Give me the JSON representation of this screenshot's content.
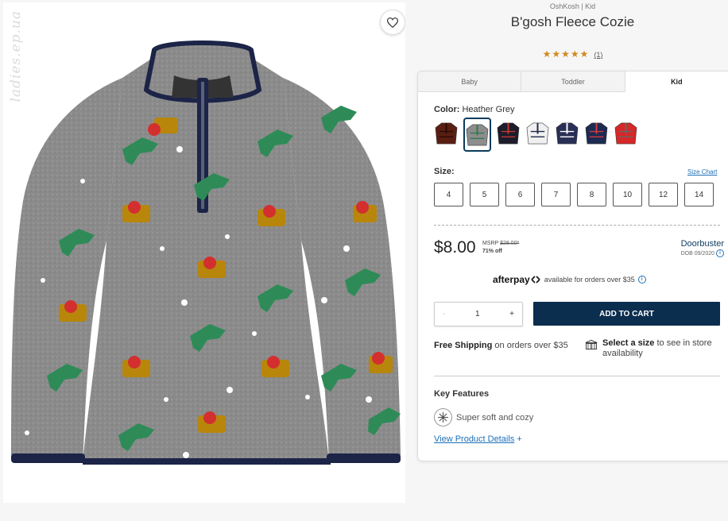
{
  "watermark": "ladies.ep.ua",
  "product": {
    "brand_line": "OshKosh | Kid",
    "title": "B'gosh Fleece Cozie",
    "stars": "★★★★★",
    "review_count": "(1)"
  },
  "tabs": [
    {
      "label": "Baby",
      "active": false
    },
    {
      "label": "Toddler",
      "active": false
    },
    {
      "label": "Kid",
      "active": true
    }
  ],
  "color": {
    "label": "Color:",
    "selected": "Heather Grey",
    "swatches": [
      {
        "name": "brown-plaid",
        "main": "#5a1e12",
        "accent": "#2a0c06"
      },
      {
        "name": "heather-grey",
        "main": "#8d8d8d",
        "accent": "#2f7a4d"
      },
      {
        "name": "black-stripe",
        "main": "#1c1c2c",
        "accent": "#c0392b"
      },
      {
        "name": "white-navy",
        "main": "#f0f0f0",
        "accent": "#1f2a4a"
      },
      {
        "name": "navy-plaid",
        "main": "#2a2f55",
        "accent": "#ffffff"
      },
      {
        "name": "navy-fairisle",
        "main": "#1d2a52",
        "accent": "#d23b3b"
      },
      {
        "name": "red-grey",
        "main": "#d62828",
        "accent": "#666666"
      }
    ]
  },
  "size": {
    "label": "Size:",
    "chart_link": "Size Chart",
    "options": [
      "4",
      "5",
      "6",
      "7",
      "8",
      "10",
      "12",
      "14"
    ]
  },
  "pricing": {
    "price": "$8.00",
    "msrp_label": "MSRP",
    "msrp_value": "$28.00*",
    "discount": "71% off",
    "promo": "Doorbuster",
    "promo_note": "DOB 09/2020",
    "info_glyph": "i"
  },
  "afterpay": {
    "logo": "afterpay",
    "text": "available for orders over $35"
  },
  "quantity": {
    "minus": "-",
    "value": "1",
    "plus": "+"
  },
  "add_to_cart": "ADD TO CART",
  "shipping": {
    "bold": "Free Shipping",
    "rest": "on orders over $35"
  },
  "store": {
    "bold": "Select a size",
    "rest": "to see in store availability"
  },
  "key_features": {
    "title": "Key Features",
    "items": [
      "Super soft and cozy"
    ],
    "link": "View Product Details",
    "link_icon": "+"
  }
}
